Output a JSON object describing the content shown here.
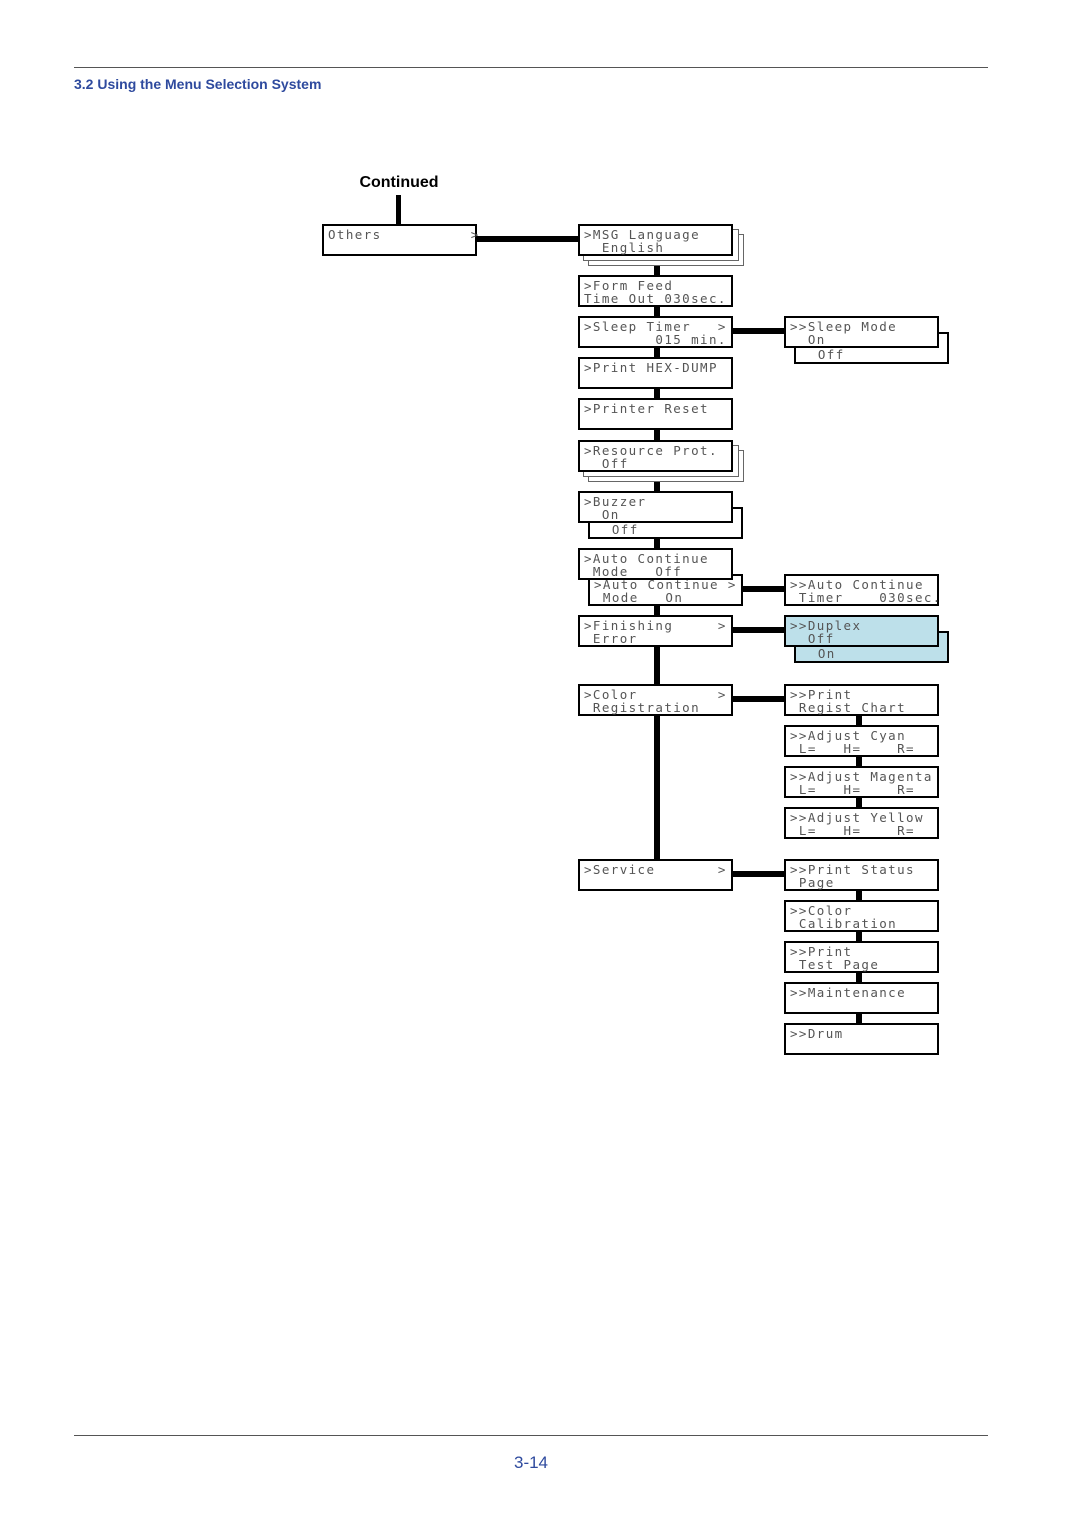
{
  "header": {
    "section_title": "3.2 Using the Menu Selection System"
  },
  "footer": {
    "page_number": "3-14"
  },
  "diagram": {
    "continued_label": "Continued",
    "others": {
      "lines": [
        "Others          >"
      ]
    },
    "main": [
      {
        "lines": [
          ">MSG Language",
          "  English"
        ]
      },
      {
        "lines": [
          ">Form Feed",
          "Time Out 030sec."
        ]
      },
      {
        "lines": [
          ">Sleep Timer   >",
          "        015 min."
        ]
      },
      {
        "lines": [
          ">Print HEX-DUMP"
        ]
      },
      {
        "lines": [
          ">Printer Reset"
        ]
      },
      {
        "lines": [
          ">Resource Prot.",
          "  Off"
        ]
      },
      {
        "lines": [
          ">Buzzer",
          "  On"
        ],
        "alt": "  Off"
      },
      {
        "lines": [
          ">Auto Continue",
          " Mode   Off"
        ]
      },
      {
        "lines": [
          ">Auto Continue >",
          " Mode   On"
        ]
      },
      {
        "lines": [
          ">Finishing     >",
          " Error"
        ]
      },
      {
        "lines": [
          ">Color         >",
          " Registration"
        ]
      },
      {
        "lines": [
          ">Service       >"
        ]
      }
    ],
    "sleep": {
      "lines": [
        ">>Sleep Mode",
        "  On"
      ],
      "alt": "  Off"
    },
    "auto_timer": {
      "lines": [
        ">>Auto Continue",
        " Timer    030sec."
      ]
    },
    "duplex": {
      "lines": [
        ">>Duplex",
        "  Off"
      ],
      "alt": "  On",
      "highlight": "#bde0ea"
    },
    "color_reg": [
      {
        "lines": [
          ">>Print",
          " Regist Chart"
        ]
      },
      {
        "lines": [
          ">>Adjust Cyan",
          " L=   H=    R="
        ]
      },
      {
        "lines": [
          ">>Adjust Magenta",
          " L=   H=    R="
        ]
      },
      {
        "lines": [
          ">>Adjust Yellow",
          " L=   H=    R="
        ]
      }
    ],
    "service": [
      {
        "lines": [
          ">>Print Status",
          " Page"
        ]
      },
      {
        "lines": [
          ">>Color",
          " Calibration"
        ]
      },
      {
        "lines": [
          ">>Print",
          " Test Page"
        ]
      },
      {
        "lines": [
          ">>Maintenance"
        ]
      },
      {
        "lines": [
          ">>Drum"
        ]
      }
    ]
  }
}
